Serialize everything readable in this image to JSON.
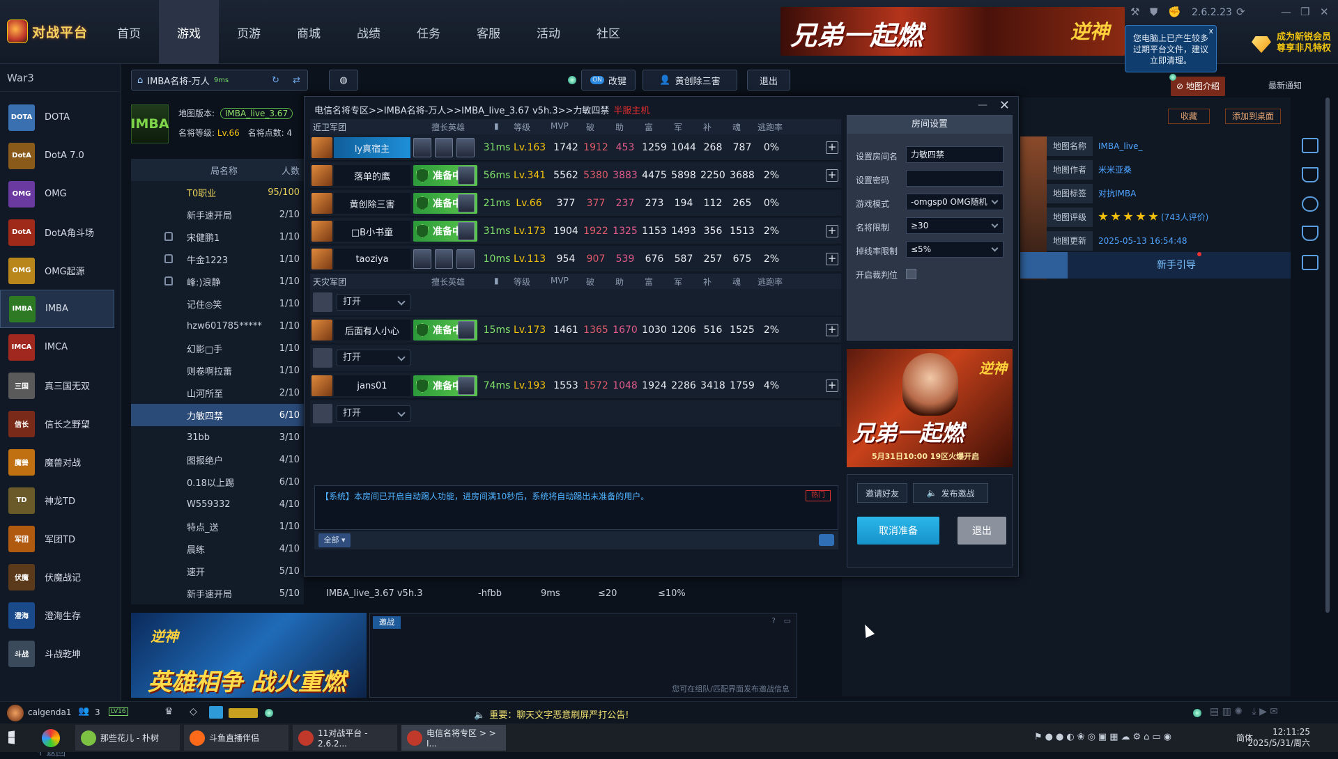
{
  "app": {
    "logo": "对战平台",
    "version": "2.6.2.23"
  },
  "nav": {
    "items": [
      "首页",
      "游戏",
      "页游",
      "商城",
      "战绩",
      "任务",
      "客服",
      "活动",
      "社区"
    ],
    "active": "游戏"
  },
  "top_banner": {
    "title": "兄弟一起燃",
    "tag": "逆神"
  },
  "tip": {
    "text": "您电脑上已产生较多过期平台文件，建议立即清理。",
    "close": "x"
  },
  "vip": {
    "line1": "成为新锐会员",
    "line2": "尊享非凡特权"
  },
  "sidebar": {
    "category": "War3",
    "games": [
      {
        "label": "DOTA",
        "icon": "DOTA",
        "color": "#3a6fb0"
      },
      {
        "label": "DotA 7.0",
        "icon": "DotA",
        "color": "#8a5a1a"
      },
      {
        "label": "OMG",
        "icon": "OMG",
        "color": "#6a3aa0"
      },
      {
        "label": "DotA角斗场",
        "icon": "DotA",
        "color": "#a02a1a"
      },
      {
        "label": "OMG起源",
        "icon": "OMG",
        "color": "#b8861a"
      },
      {
        "label": "IMBA",
        "icon": "IMBA",
        "color": "#2e7a24"
      },
      {
        "label": "IMCA",
        "icon": "IMCA",
        "color": "#a0281e"
      },
      {
        "label": "真三国无双",
        "icon": "三国",
        "color": "#5a5a5a"
      },
      {
        "label": "信长之野望",
        "icon": "信长",
        "color": "#7a2a18"
      },
      {
        "label": "魔兽对战",
        "icon": "魔兽",
        "color": "#c07010"
      },
      {
        "label": "神龙TD",
        "icon": "TD",
        "color": "#6a5a2a"
      },
      {
        "label": "军团TD",
        "icon": "军团",
        "color": "#b05a10"
      },
      {
        "label": "伏魔战记",
        "icon": "伏魔",
        "color": "#5a3a1a"
      },
      {
        "label": "澄海生存",
        "icon": "澄海",
        "color": "#1a4a8a"
      },
      {
        "label": "斗战乾坤",
        "icon": "斗战",
        "color": "#3a4a5a"
      }
    ],
    "active": "IMBA",
    "back": "返回"
  },
  "toolbar": {
    "room_search": "IMBA名将-万人",
    "room_ping": "9ms",
    "toggle_label": "ON",
    "rebuild": "改键",
    "host_user": "黄创除三害",
    "exit": "退出"
  },
  "map_info": {
    "logo": "IMBA",
    "version_label": "地图版本:",
    "version_value": "IMBA_live_3.67",
    "rank_label": "名将等级:",
    "rank_value": "Lv.66",
    "points_label": "名将点数:",
    "points_value": "4"
  },
  "room_list": {
    "col_name": "局名称",
    "col_count": "人数",
    "rows": [
      {
        "name": "T0职业",
        "count": "95/100",
        "locked": false,
        "color": "#e8d25a"
      },
      {
        "name": "新手速开局",
        "count": "2/10",
        "locked": false,
        "color": "#c8d0dc"
      },
      {
        "name": "宋健鹏1",
        "count": "1/10",
        "locked": true,
        "color": "#c8d0dc"
      },
      {
        "name": "牛金1223",
        "count": "1/10",
        "locked": true,
        "color": "#c8d0dc"
      },
      {
        "name": "峰:)浪静",
        "count": "1/10",
        "locked": true,
        "color": "#c8d0dc"
      },
      {
        "name": "记住◎笑",
        "count": "1/10",
        "locked": false,
        "color": "#c8d0dc"
      },
      {
        "name": "hzw601785*****",
        "count": "1/10",
        "locked": false,
        "color": "#c8d0dc"
      },
      {
        "name": "幻影□手",
        "count": "1/10",
        "locked": false,
        "color": "#c8d0dc"
      },
      {
        "name": "则卷啊拉蕾",
        "count": "1/10",
        "locked": false,
        "color": "#c8d0dc"
      },
      {
        "name": "山河所至",
        "count": "2/10",
        "locked": false,
        "color": "#c8d0dc"
      },
      {
        "name": "力敏四禁",
        "count": "6/10",
        "locked": false,
        "color": "#ffffff"
      },
      {
        "name": "31bb",
        "count": "3/10",
        "locked": false,
        "color": "#c8d0dc"
      },
      {
        "name": "图报绝户",
        "count": "4/10",
        "locked": false,
        "color": "#c8d0dc"
      },
      {
        "name": "0.18以上踢",
        "count": "6/10",
        "locked": false,
        "color": "#c8d0dc"
      },
      {
        "name": "W559332",
        "count": "4/10",
        "locked": false,
        "color": "#c8d0dc"
      },
      {
        "name": "特点_送",
        "count": "1/10",
        "locked": false,
        "color": "#c8d0dc"
      },
      {
        "name": "晨练",
        "count": "4/10",
        "locked": false,
        "color": "#c8d0dc"
      },
      {
        "name": "速开",
        "count": "5/10",
        "locked": false,
        "color": "#c8d0dc"
      },
      {
        "name": "新手速开局",
        "count": "5/10",
        "locked": false,
        "color": "#c8d0dc"
      }
    ],
    "selected": "力敏四禁"
  },
  "extra_cols": [
    {
      "map": "IMBA_live_3.67 v5h.3",
      "mode": "-hfbb",
      "ping": "9ms",
      "level": "≤20",
      "flee": "≤10%"
    }
  ],
  "room": {
    "title": "电信名将专区>>IMBA名将-万人>>IMBA_live_3.67 v5h.3>>力敏四禁",
    "host_tag": "半服主机",
    "headers": {
      "hero": "擅长英雄",
      "level": "等级",
      "mvp": "MVP",
      "po": "破",
      "zhu": "助",
      "fu": "富",
      "jun": "军",
      "bu": "补",
      "hun": "魂",
      "flee": "逃跑率"
    },
    "team1": "近卫军团",
    "team2": "天灾军团",
    "open_label": "打开",
    "players1": [
      {
        "name": "ly真宿主",
        "highlight": true,
        "ready": false,
        "ping": "31ms",
        "level": "Lv.163",
        "mvp": "1742",
        "po": "1912",
        "zhu": "453",
        "fu": "1259",
        "jun": "1044",
        "bu": "268",
        "hun": "787",
        "flee": "0%",
        "plus": true
      },
      {
        "name": "落单的鹰",
        "highlight": false,
        "ready": true,
        "ping": "56ms",
        "level": "Lv.341",
        "mvp": "5562",
        "po": "5380",
        "zhu": "3883",
        "fu": "4475",
        "jun": "5898",
        "bu": "2250",
        "hun": "3688",
        "flee": "2%",
        "plus": true
      },
      {
        "name": "黄创除三害",
        "highlight": false,
        "ready": true,
        "ping": "21ms",
        "level": "Lv.66",
        "mvp": "377",
        "po": "377",
        "zhu": "237",
        "fu": "273",
        "jun": "194",
        "bu": "112",
        "hun": "265",
        "flee": "0%",
        "plus": false
      },
      {
        "name": "□B小书童",
        "highlight": false,
        "ready": true,
        "ping": "31ms",
        "level": "Lv.173",
        "mvp": "1904",
        "po": "1922",
        "zhu": "1325",
        "fu": "1153",
        "jun": "1493",
        "bu": "356",
        "hun": "1513",
        "flee": "2%",
        "plus": true
      },
      {
        "name": "taoziya",
        "highlight": false,
        "ready": false,
        "ping": "10ms",
        "level": "Lv.113",
        "mvp": "954",
        "po": "907",
        "zhu": "539",
        "fu": "676",
        "jun": "587",
        "bu": "257",
        "hun": "675",
        "flee": "2%",
        "plus": true
      }
    ],
    "players2": [
      {
        "name": "后面有人小心",
        "highlight": false,
        "ready": true,
        "ping": "15ms",
        "level": "Lv.173",
        "mvp": "1461",
        "po": "1365",
        "zhu": "1670",
        "fu": "1030",
        "jun": "1206",
        "bu": "516",
        "hun": "1525",
        "flee": "2%",
        "plus": true
      },
      {
        "name": "jans01",
        "highlight": false,
        "ready": true,
        "ping": "74ms",
        "level": "Lv.193",
        "mvp": "1553",
        "po": "1572",
        "zhu": "1048",
        "fu": "1924",
        "jun": "2286",
        "bu": "3418",
        "hun": "1759",
        "flee": "4%",
        "plus": true
      }
    ],
    "ready_label": "准备中",
    "chat_system": "【系统】本房间已开启自动踢人功能，进房间满10秒后，系统将自动踢出未准备的用户。",
    "hot_label": "热门",
    "chat_filter": "全部",
    "settings": {
      "title": "房间设置",
      "name_label": "设置房间名",
      "name_value": "力敏四禁",
      "pwd_label": "设置密码",
      "pwd_value": "",
      "mode_label": "游戏模式",
      "mode_value": "-omgsp0 OMG随机",
      "rank_label": "名将限制",
      "rank_value": "≥30",
      "drop_label": "掉线率限制",
      "drop_value": "≤5%",
      "referee_label": "开启裁判位"
    },
    "ad": {
      "title": "兄弟一起燃",
      "date": "5月31日10:00 19区火爆开启",
      "tag": "逆神"
    },
    "invite_friends": "邀请好友",
    "post_invite": "发布邀战",
    "cancel_ready": "取消准备",
    "exit": "退出"
  },
  "right_panel": {
    "tab_intro": "地图介绍",
    "tab_news": "最新通知",
    "favorite": "收藏",
    "add_desktop": "添加到桌面",
    "info": [
      {
        "k": "地图名称",
        "v": "IMBA_live_"
      },
      {
        "k": "地图作者",
        "v": "米米亚桑"
      },
      {
        "k": "地图标签",
        "v": "对抗IMBA"
      },
      {
        "k": "地图评级",
        "v": "(743人评价)"
      },
      {
        "k": "地图更新",
        "v": "2025-05-13 16:54:48"
      }
    ],
    "rating_stars": 5,
    "guide": "新手引导"
  },
  "lower_banner": {
    "title": "英雄相争 战火重燃",
    "tag": "逆神"
  },
  "invite_panel": {
    "tab": "邀战",
    "hint": "您可在组队/匹配界面发布邀战信息"
  },
  "status_bar": {
    "user": "calgenda1",
    "friends": "3",
    "level": "LV16",
    "announce": "重要：聊天文字恶意刷屏严打公告!"
  },
  "taskbar": {
    "tasks": [
      {
        "label": "那些花儿 - 朴树",
        "color": "#7dc242"
      },
      {
        "label": "斗鱼直播伴侣",
        "color": "#ff6a1a"
      },
      {
        "label": "11对战平台 - 2.6.2...",
        "color": "#c0392b"
      },
      {
        "label": "电信名将专区 > > I...",
        "color": "#c0392b"
      }
    ],
    "ime": "简体",
    "time": "12:11:25",
    "date": "2025/5/31/周六"
  }
}
